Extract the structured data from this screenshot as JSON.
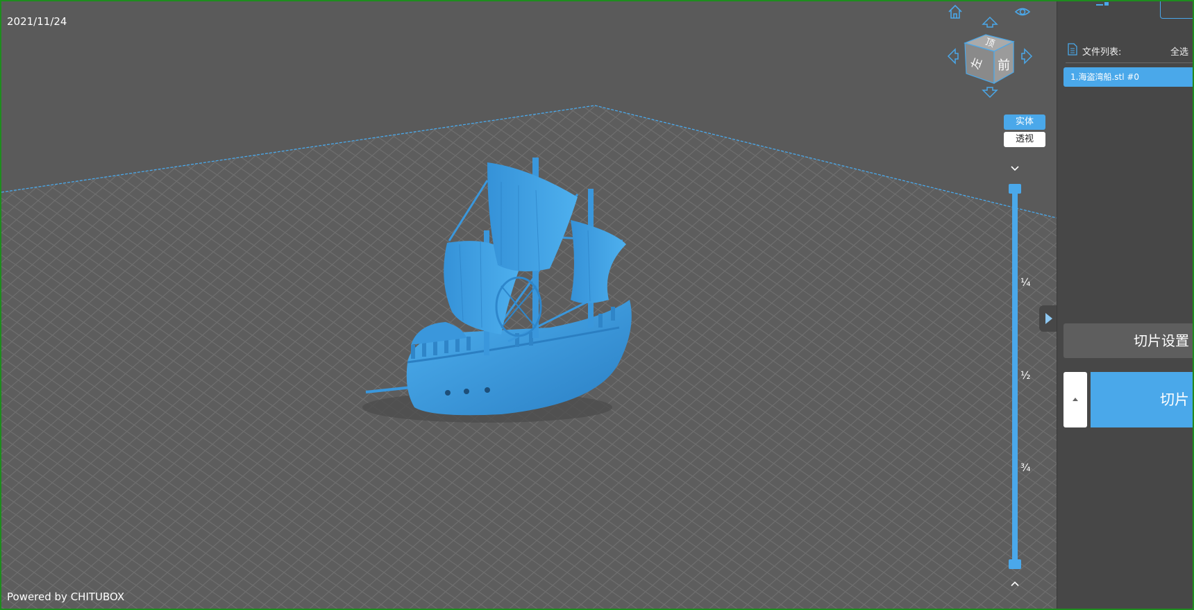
{
  "viewport": {
    "date": "2021/11/24",
    "powered_by": "Powered by CHITUBOX",
    "model_color": "#3a97dc"
  },
  "nav_cube": {
    "top_label": "顶",
    "front_label": "前",
    "left_label": "左",
    "icons": [
      "home-icon",
      "eye-icon",
      "arrow-up-icon",
      "arrow-left-icon",
      "arrow-right-icon",
      "arrow-down-icon"
    ]
  },
  "view_modes": {
    "solid_label": "实体",
    "perspective_label": "透视",
    "active": "solid"
  },
  "layer_slider": {
    "marks": [
      "¼",
      "½",
      "¾"
    ]
  },
  "panel": {
    "file_list_label": "文件列表:",
    "select_all_label": "全选",
    "files": [
      {
        "name": "1.海盗湾船.stl #0",
        "selected": true
      }
    ],
    "slice_settings_label": "切片设置",
    "slice_label": "切片"
  },
  "colors": {
    "accent": "#4aa8ea",
    "viewport_bg": "#5b5b5b",
    "panel_bg": "#474747",
    "window_border": "#1e8c1e"
  }
}
